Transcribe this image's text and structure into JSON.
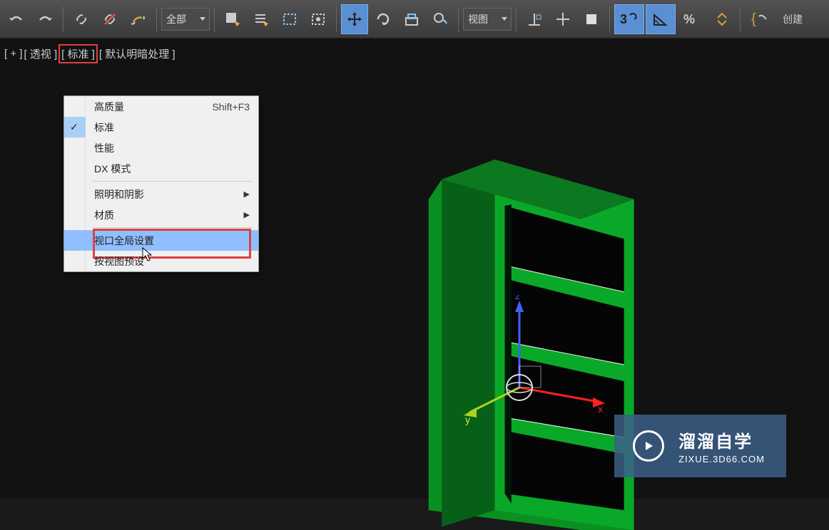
{
  "toolbar": {
    "filter_dropdown": "全部",
    "view_dropdown": "视图",
    "create_button": "创建"
  },
  "viewport_labels": {
    "plus": "+",
    "perspective": "透视",
    "standard": "标准",
    "shading": "默认明暗处理"
  },
  "context_menu": {
    "high_quality": "高质量",
    "high_quality_shortcut": "Shift+F3",
    "standard": "标准",
    "performance": "性能",
    "dx_mode": "DX 模式",
    "lighting_shadows": "照明和阴影",
    "materials": "材质",
    "viewport_global_settings": "视口全局设置",
    "preview_by_view": "按视图预设"
  },
  "gizmo": {
    "x_label": "x",
    "y_label": "y",
    "z_label": "z"
  },
  "watermark": {
    "title": "溜溜自学",
    "url": "ZIXUE.3D66.COM"
  }
}
